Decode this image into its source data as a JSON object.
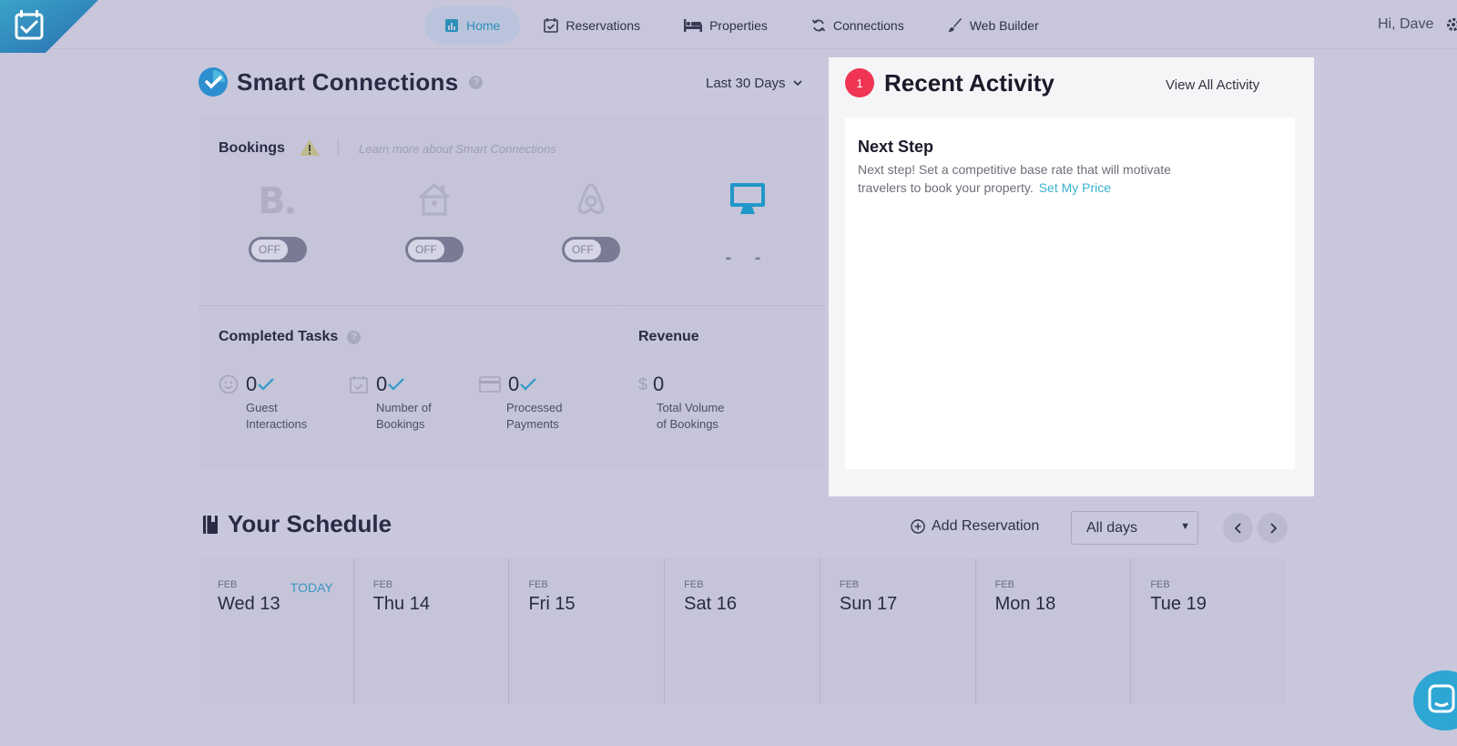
{
  "nav": {
    "items": [
      {
        "label": "Home",
        "icon": "bar-chart-icon",
        "active": true
      },
      {
        "label": "Reservations",
        "icon": "calendar-check-icon",
        "active": false
      },
      {
        "label": "Properties",
        "icon": "bed-icon",
        "active": false
      },
      {
        "label": "Connections",
        "icon": "sync-icon",
        "active": false
      },
      {
        "label": "Web Builder",
        "icon": "brush-icon",
        "active": false
      }
    ],
    "greeting": "Hi, Dave"
  },
  "smart": {
    "title": "Smart Connections",
    "help": "?",
    "range": "Last 30 Days"
  },
  "bookings": {
    "title": "Bookings",
    "learn": "Learn more about Smart Connections",
    "channels": [
      {
        "name": "booking-com",
        "state": "OFF"
      },
      {
        "name": "homeaway",
        "state": "OFF"
      },
      {
        "name": "airbnb",
        "state": "OFF"
      },
      {
        "name": "website",
        "state": "- -"
      }
    ]
  },
  "tasks": {
    "title": "Completed Tasks",
    "help": "?",
    "stats": [
      {
        "value": "0",
        "label1": "Guest",
        "label2": "Interactions"
      },
      {
        "value": "0",
        "label1": "Number of",
        "label2": "Bookings"
      },
      {
        "value": "0",
        "label1": "Processed",
        "label2": "Payments"
      }
    ]
  },
  "revenue": {
    "title": "Revenue",
    "currency": "$",
    "value": "0",
    "label1": "Total Volume",
    "label2": "of Bookings"
  },
  "activity": {
    "badge": "1",
    "title": "Recent Activity",
    "view_all": "View All Activity",
    "card_title": "Next Step",
    "card_text": "Next step! Set a competitive base rate that will motivate travelers to book your property.",
    "card_link": "Set My Price"
  },
  "schedule": {
    "title": "Your Schedule",
    "add": "Add Reservation",
    "filter": "All days",
    "today_label": "TODAY",
    "days": [
      {
        "month": "FEB",
        "date": "Wed 13"
      },
      {
        "month": "FEB",
        "date": "Thu 14"
      },
      {
        "month": "FEB",
        "date": "Fri 15"
      },
      {
        "month": "FEB",
        "date": "Sat 16"
      },
      {
        "month": "FEB",
        "date": "Sun 17"
      },
      {
        "month": "FEB",
        "date": "Mon 18"
      },
      {
        "month": "FEB",
        "date": "Tue 19"
      }
    ]
  },
  "colors": {
    "accent": "#2d8fb8",
    "badge": "#ef3553",
    "link": "#39b2d0"
  }
}
